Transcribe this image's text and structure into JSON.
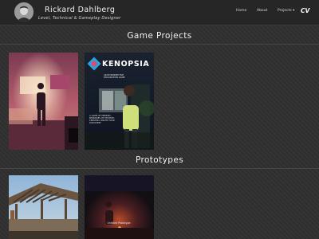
{
  "header": {
    "name": "Rickard Dahlberg",
    "subtitle": "Level, Technical & Gameplay Designer",
    "nav": {
      "home": "Home",
      "about": "About",
      "projects": "Projects ▾",
      "cv": "CV"
    }
  },
  "sections": {
    "games": "Game Projects",
    "prototypes": "Prototypes"
  },
  "kenopsia": {
    "title": "KENOPSIA",
    "subtitle": "AN INTROSPECTIVE EXPLORATION GAME",
    "description": "A GAME OF MEMORY, MEMORIES OF MYSTERY, KENOPSIA AWAITS YOUR DISCOVERY"
  },
  "prototype2": {
    "label": "Untitled Prototype"
  },
  "colors": {
    "header_bg": "#262626",
    "page_bg": "#2f2f2f",
    "kenopsia_blue": "#29a3d6",
    "kenopsia_pink": "#e0457b"
  }
}
